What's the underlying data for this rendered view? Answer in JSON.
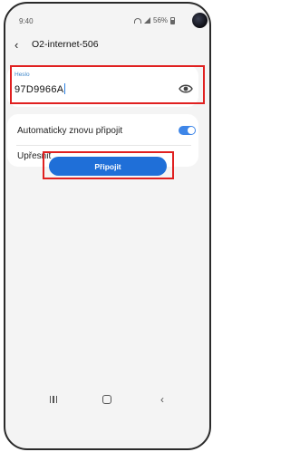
{
  "status_bar": {
    "time": "9:40",
    "battery": "56%",
    "icons": [
      "wifi-icon",
      "signal-icon",
      "battery-icon"
    ]
  },
  "header": {
    "title": "O2-internet-506",
    "back_icon": "back-arrow-icon"
  },
  "password": {
    "label": "Heslo",
    "value": "97D9966A",
    "visibility_icon": "eye-icon"
  },
  "options": {
    "auto_reconnect_label": "Automaticky znovu připojit",
    "auto_reconnect_on": true,
    "refine_label": "Upřesnit"
  },
  "actions": {
    "connect_label": "Připojit"
  },
  "nav": {
    "icons": [
      "recent-apps-icon",
      "home-icon",
      "back-icon"
    ]
  },
  "colors": {
    "accent": "#1f6fd8",
    "highlight": "#e02020",
    "label_blue": "#3e86c9",
    "background": "#f4f4f4"
  }
}
